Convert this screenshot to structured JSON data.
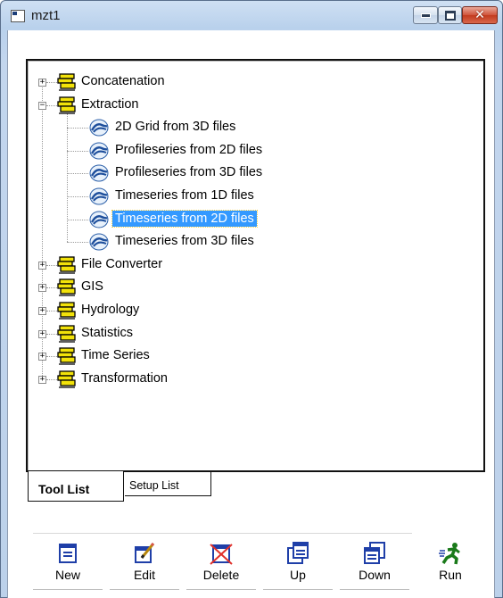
{
  "window": {
    "title": "mzt1"
  },
  "tree": {
    "folders": [
      {
        "label": "Concatenation",
        "expanded": false
      },
      {
        "label": "Extraction",
        "expanded": true
      },
      {
        "label": "File Converter",
        "expanded": false
      },
      {
        "label": "GIS",
        "expanded": false
      },
      {
        "label": "Hydrology",
        "expanded": false
      },
      {
        "label": "Statistics",
        "expanded": false
      },
      {
        "label": "Time Series",
        "expanded": false
      },
      {
        "label": "Transformation",
        "expanded": false
      }
    ],
    "extraction_items": [
      "2D Grid from 3D files",
      "Profileseries from 2D files",
      "Profileseries from 3D files",
      "Timeseries from 1D files",
      "Timeseries from 2D files",
      "Timeseries from 3D files"
    ],
    "selected": "Timeseries from 2D files"
  },
  "tabs": {
    "tool_list": "Tool List",
    "setup_list": "Setup List"
  },
  "toolbar": {
    "new": "New",
    "edit": "Edit",
    "delete": "Delete",
    "up": "Up",
    "down": "Down",
    "run": "Run"
  },
  "colors": {
    "selection": "#3399ff",
    "folder": "#f2e20a",
    "close_button": "#c9452a"
  }
}
